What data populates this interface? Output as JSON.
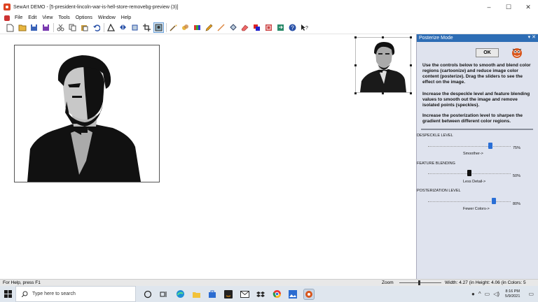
{
  "window": {
    "title": "SewArt DEMO - [5-president-lincoln-war-is-hell-store-removebg-preview (3)]",
    "controls": [
      "–",
      "☐",
      "✕"
    ]
  },
  "menu": [
    "File",
    "Edit",
    "View",
    "Tools",
    "Options",
    "Window",
    "Help"
  ],
  "panel": {
    "title": "Posterize Mode",
    "ok_label": "OK",
    "paragraphs": [
      "Use the controls below to smooth and blend color regions (cartoonize) and reduce image color content (posterize). Drag the sliders to see the effect on the image.",
      "Increase the despeckle level and feature blending values to  smooth out the image and remove isolated points (speckles).",
      "Increase the posterization level to sharpen the gradient between different color regions."
    ],
    "sliders": [
      {
        "label": "DESPECKLE LEVEL",
        "value": "75%",
        "hint": "Smoother->",
        "fraction": 0.75,
        "color": "#2a6fd6"
      },
      {
        "label": "FEATURE BLENDING",
        "value": "50%",
        "hint": "Less Detail->",
        "fraction": 0.5,
        "color": "#111111"
      },
      {
        "label": "POSTERIZATION LEVEL",
        "value": "80%",
        "hint": "Fewer Colors->",
        "fraction": 0.8,
        "color": "#2a6fd6"
      }
    ]
  },
  "status": {
    "help": "For Help, press F1",
    "zoom_label": "Zoom",
    "dims": "Width: 4.27 (in Height: 4.06 (in Colors: 5"
  },
  "taskbar": {
    "search_placeholder": "Type here to search",
    "time": "8:16 PM",
    "date": "5/9/2021"
  },
  "colors": {
    "panel_header": "#2d6db5",
    "panel_bg": "#dfe3ee",
    "accent_blue": "#2a6fd6"
  }
}
